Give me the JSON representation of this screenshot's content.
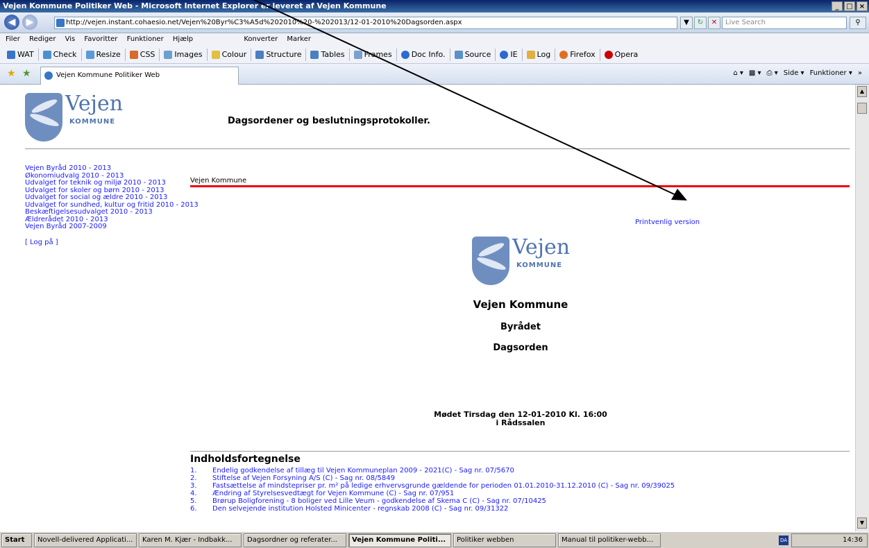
{
  "window": {
    "title": "Vejen Kommune Politiker Web - Microsoft Internet Explorer er leveret af Vejen Kommune",
    "controls": [
      "_",
      "□",
      "×"
    ]
  },
  "addressbar": {
    "url": "http://vejen.instant.cohaesio.net/Vejen%20Byr%C3%A5d%202010%20-%202013/12-01-2010%20Dagsorden.aspx",
    "search_placeholder": "Live Search"
  },
  "menubar": {
    "items": [
      "Filer",
      "Rediger",
      "Vis",
      "Favoritter",
      "Funktioner",
      "Hjælp"
    ],
    "extras": [
      "Konverter",
      "Marker"
    ]
  },
  "linksbar": {
    "items": [
      "WAT",
      "Check",
      "Resize",
      "CSS",
      "Images",
      "Colour",
      "Structure",
      "Tables",
      "Frames",
      "Doc Info.",
      "Source",
      "IE",
      "Log",
      "Firefox",
      "Opera"
    ]
  },
  "tab": {
    "label": "Vejen Kommune Politiker Web"
  },
  "commandbar": {
    "items": [
      "Side",
      "Funktioner"
    ]
  },
  "logo": {
    "word": "Vejen",
    "sub": "KOMMUNE"
  },
  "page": {
    "header_title": "Dagsordener og beslutningsprotokoller.",
    "breadcrumb": "Vejen Kommune",
    "print_link": "Printvenlig version",
    "org_title": "Vejen Kommune",
    "body_title": "Byrådet",
    "doc_type": "Dagsorden",
    "meeting_line1": "Mødet Tirsdag den 12-01-2010 Kl. 16:00",
    "meeting_line2": "i Rådssalen",
    "toc_title": "Indholdsfortegnelse"
  },
  "leftnav": {
    "items": [
      "Vejen Byråd 2010 - 2013",
      "Økonomiudvalg 2010 - 2013",
      "Udvalget for teknik og miljø 2010 - 2013",
      "Udvalget for skoler og børn 2010 - 2013",
      "Udvalget for social og ældre 2010 - 2013",
      "Udvalget for sundhed, kultur og fritid 2010 - 2013",
      "Beskæftigelsesudvalget 2010 - 2013",
      "Ældrerådet 2010 - 2013",
      "Vejen Byråd 2007-2009"
    ],
    "login": "[ Log på ]"
  },
  "toc": [
    {
      "num": "1.",
      "text": "Endelig godkendelse af tillæg til Vejen Kommuneplan 2009 - 2021(C) - Sag nr. 07/5670"
    },
    {
      "num": "2.",
      "text": "Stiftelse af Vejen Forsyning A/S (C) - Sag nr. 08/5849"
    },
    {
      "num": "3.",
      "text": "Fastsættelse af mindstepriser pr. m² på ledige erhvervsgrunde gældende for perioden 01.01.2010-31.12.2010 (C) - Sag nr. 09/39025"
    },
    {
      "num": "4.",
      "text": "Ændring af Styrelsesvedtægt for Vejen Kommune (C) - Sag nr. 07/951"
    },
    {
      "num": "5.",
      "text": "Brørup Boligforening - 8 boliger ved Lille Veum - godkendelse af Skema C (C) - Sag nr. 07/10425"
    },
    {
      "num": "6.",
      "text": "Den selvejende institution Holsted Minicenter - regnskab 2008 (C) - Sag nr. 09/31322"
    }
  ],
  "taskbar": {
    "start": "Start",
    "buttons": [
      "Novell-delivered Applicati...",
      "Karen M. Kjær - Indbakk...",
      "Dagsordner og referater...",
      "Vejen Kommune Politi...",
      "Politiker webben",
      "Manual til politiker-webb..."
    ],
    "language": "DA",
    "clock": "14:36"
  }
}
